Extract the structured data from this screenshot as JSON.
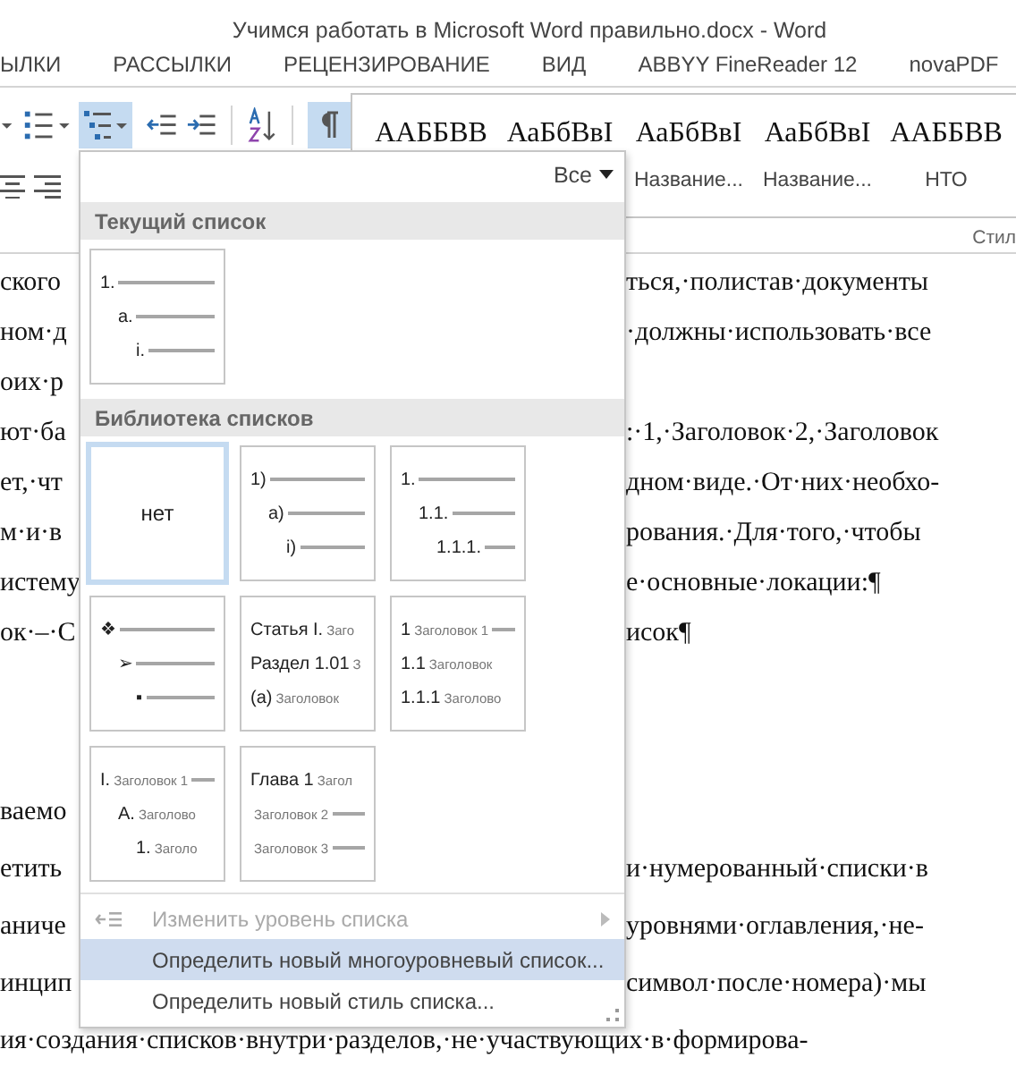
{
  "window": {
    "title": "Учимся работать в Microsoft Word правильно.docx - Word"
  },
  "tabs": [
    {
      "label": "ЫЛКИ",
      "selected": false
    },
    {
      "label": "РАССЫЛКИ",
      "selected": false
    },
    {
      "label": "РЕЦЕНЗИРОВАНИЕ",
      "selected": false
    },
    {
      "label": "ВИД",
      "selected": false
    },
    {
      "label": "ABBYY FineReader 12",
      "selected": false
    },
    {
      "label": "novaPDF",
      "selected": false
    }
  ],
  "ribbon": {
    "multilevel_list_on": true,
    "show_marks_on": true,
    "styles": [
      {
        "preview": "ААББВВ"
      },
      {
        "preview": "АаБбВвI"
      },
      {
        "preview": "АаБбВвI",
        "caption": "Название..."
      },
      {
        "preview": "АаБбВвI",
        "caption": "Название..."
      },
      {
        "preview": "ААББВВ",
        "caption": "НТО"
      }
    ],
    "group_label": "Стил"
  },
  "document": {
    "paragraphs": [
      [
        {
          "left": "ского",
          "right": "ться,·полистав·документы"
        },
        {
          "left": "ном·д",
          "right": "·должны·использовать·все"
        },
        {
          "left": "оих·р"
        },
        {
          "left": "ют·ба",
          "right": ":·1,·Заголовок·2,·Заголовок"
        },
        {
          "left": "ет,·чт",
          "right": "дном·виде.·От·них·необхо-"
        },
        {
          "left": "м·и·в",
          "right": "рования.·Для·того,·чтобы"
        },
        {
          "left": "истему",
          "right": "е·основные·локации:¶"
        },
        {
          "left": "ок·–·С",
          "right": "исок¶"
        }
      ],
      [
        {
          "left": "ваемо"
        },
        {
          "left": "етить",
          "right": "и·нумерованный·списки·в"
        },
        {
          "left": "аниче",
          "right": "уровнями·оглавления,·не-"
        },
        {
          "left": "инцип",
          "right": "символ·после·номера)·мы"
        }
      ]
    ],
    "last_line": "ия·создания·списков·внутри·разделов,·не·участвующих·в·формирова-"
  },
  "list_menu": {
    "filter": "Все",
    "current_header": "Текущий список",
    "current": [
      {
        "kind": "indented",
        "selected": false,
        "lines": [
          {
            "marker": "1.",
            "rule": true
          },
          {
            "marker": "a.",
            "rule": true
          },
          {
            "marker": "i.",
            "rule": true
          }
        ]
      }
    ],
    "library_header": "Библиотека списков",
    "library": [
      {
        "kind": "none",
        "label": "нет",
        "selected": true
      },
      {
        "kind": "indented",
        "selected": false,
        "lines": [
          {
            "marker": "1)",
            "rule": true
          },
          {
            "marker": "a)",
            "rule": true
          },
          {
            "marker": "i)",
            "rule": true
          }
        ]
      },
      {
        "kind": "indented",
        "selected": false,
        "lines": [
          {
            "marker": "1.",
            "rule": true
          },
          {
            "marker": "1.1.",
            "rule": true
          },
          {
            "marker": "1.1.1.",
            "rule": true
          }
        ]
      },
      {
        "kind": "indented",
        "selected": false,
        "lines": [
          {
            "marker": "❖",
            "rule": true
          },
          {
            "marker": "➢",
            "rule": true
          },
          {
            "marker": "▪",
            "rule": true
          }
        ]
      },
      {
        "kind": "flush",
        "selected": false,
        "lines": [
          {
            "marker": "Статья I.",
            "text": "Заго"
          },
          {
            "marker": "Раздел 1.01",
            "text": "З"
          },
          {
            "marker": "(а)",
            "text": "Заголовок"
          }
        ]
      },
      {
        "kind": "flush",
        "selected": false,
        "lines": [
          {
            "marker": "1",
            "text": "Заголовок 1",
            "rule": true
          },
          {
            "marker": "1.1",
            "text": "Заголовок"
          },
          {
            "marker": "1.1.1",
            "text": "Заголово"
          }
        ]
      },
      {
        "kind": "indented",
        "selected": false,
        "lines": [
          {
            "marker": "I.",
            "text": "Заголовок 1",
            "rule": true
          },
          {
            "marker": "A.",
            "text": "Заголово"
          },
          {
            "marker": "1.",
            "text": "Заголо"
          }
        ]
      },
      {
        "kind": "flush",
        "selected": false,
        "lines": [
          {
            "marker": "Глава 1",
            "text": "Загол"
          },
          {
            "text": "Заголовок 2",
            "rule": true
          },
          {
            "text": "Заголовок 3",
            "rule": true
          }
        ]
      }
    ],
    "items": [
      {
        "kind": "submenu",
        "label": "Изменить уровень списка",
        "disabled": true,
        "selected": false
      },
      {
        "kind": "command",
        "label": "Определить новый многоуровневый список...",
        "disabled": false,
        "selected": true
      },
      {
        "kind": "command",
        "label": "Определить новый стиль списка...",
        "disabled": false,
        "selected": false
      }
    ]
  }
}
